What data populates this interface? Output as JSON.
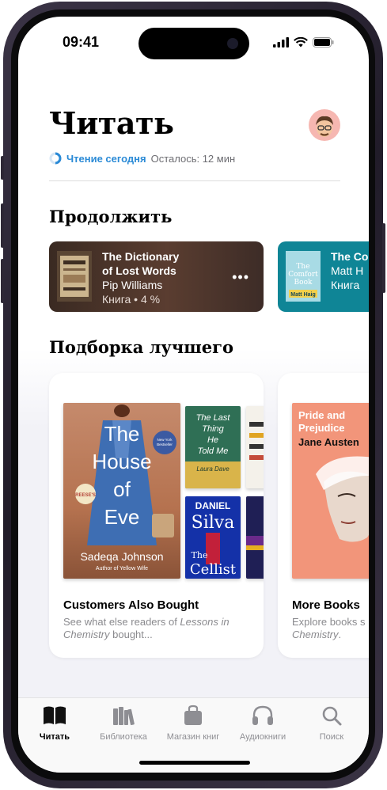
{
  "status": {
    "time": "09:41"
  },
  "header": {
    "title": "Читать",
    "reading_label": "Чтение сегодня",
    "reading_remaining": "Осталось: 12 мин"
  },
  "continue": {
    "section_title": "Продолжить",
    "cards": [
      {
        "title_line1": "The Dictionary",
        "title_line2": "of Lost Words",
        "author": "Pip Williams",
        "meta": "Книга • 4 %",
        "more": "•••",
        "accent": "#4a3329"
      },
      {
        "title_line1": "The Co",
        "author": "Matt H",
        "meta": "Книга",
        "cover_title": "The Comfort Book",
        "cover_author": "Matt Haig",
        "accent": "#0f8596"
      }
    ]
  },
  "top_picks": {
    "section_title": "Подборка лучшего",
    "cards": [
      {
        "title": "Customers Also Bought",
        "desc_line1": "See what else readers of ",
        "desc_italic1": "Lessons in",
        "desc_italic2": "Chemistry",
        "desc_line2_tail": " bought...",
        "books": {
          "main": {
            "title_lines": [
              "The",
              "House",
              "of",
              "Eve"
            ],
            "author": "Sadeqa Johnson",
            "byline": "Author of Yellow Wife",
            "badge": "New York Times Bestseller",
            "sticker": "REESE'S BOOK CLUB"
          },
          "b2": {
            "title_lines": [
              "The Last",
              "Thing",
              "He",
              "Told Me"
            ],
            "author": "Laura Dave"
          },
          "b3": {
            "title_lines": [
              "DANIEL",
              "Silva",
              "The",
              "Cellist"
            ]
          }
        }
      },
      {
        "title": "More Books",
        "desc_line1": "Explore books s",
        "desc_italic2": "Chemistry",
        "desc_line2_tail": ".",
        "books": {
          "main": {
            "title_lines": [
              "Pride and",
              "Prejudice"
            ],
            "author": "Jane Austen"
          }
        }
      }
    ]
  },
  "tabbar": {
    "items": [
      {
        "label": "Читать",
        "icon": "book-open-icon",
        "active": true
      },
      {
        "label": "Библиотека",
        "icon": "library-icon",
        "active": false
      },
      {
        "label": "Магазин книг",
        "icon": "bag-icon",
        "active": false
      },
      {
        "label": "Аудиокниги",
        "icon": "headphones-icon",
        "active": false
      },
      {
        "label": "Поиск",
        "icon": "search-icon",
        "active": false
      }
    ]
  }
}
